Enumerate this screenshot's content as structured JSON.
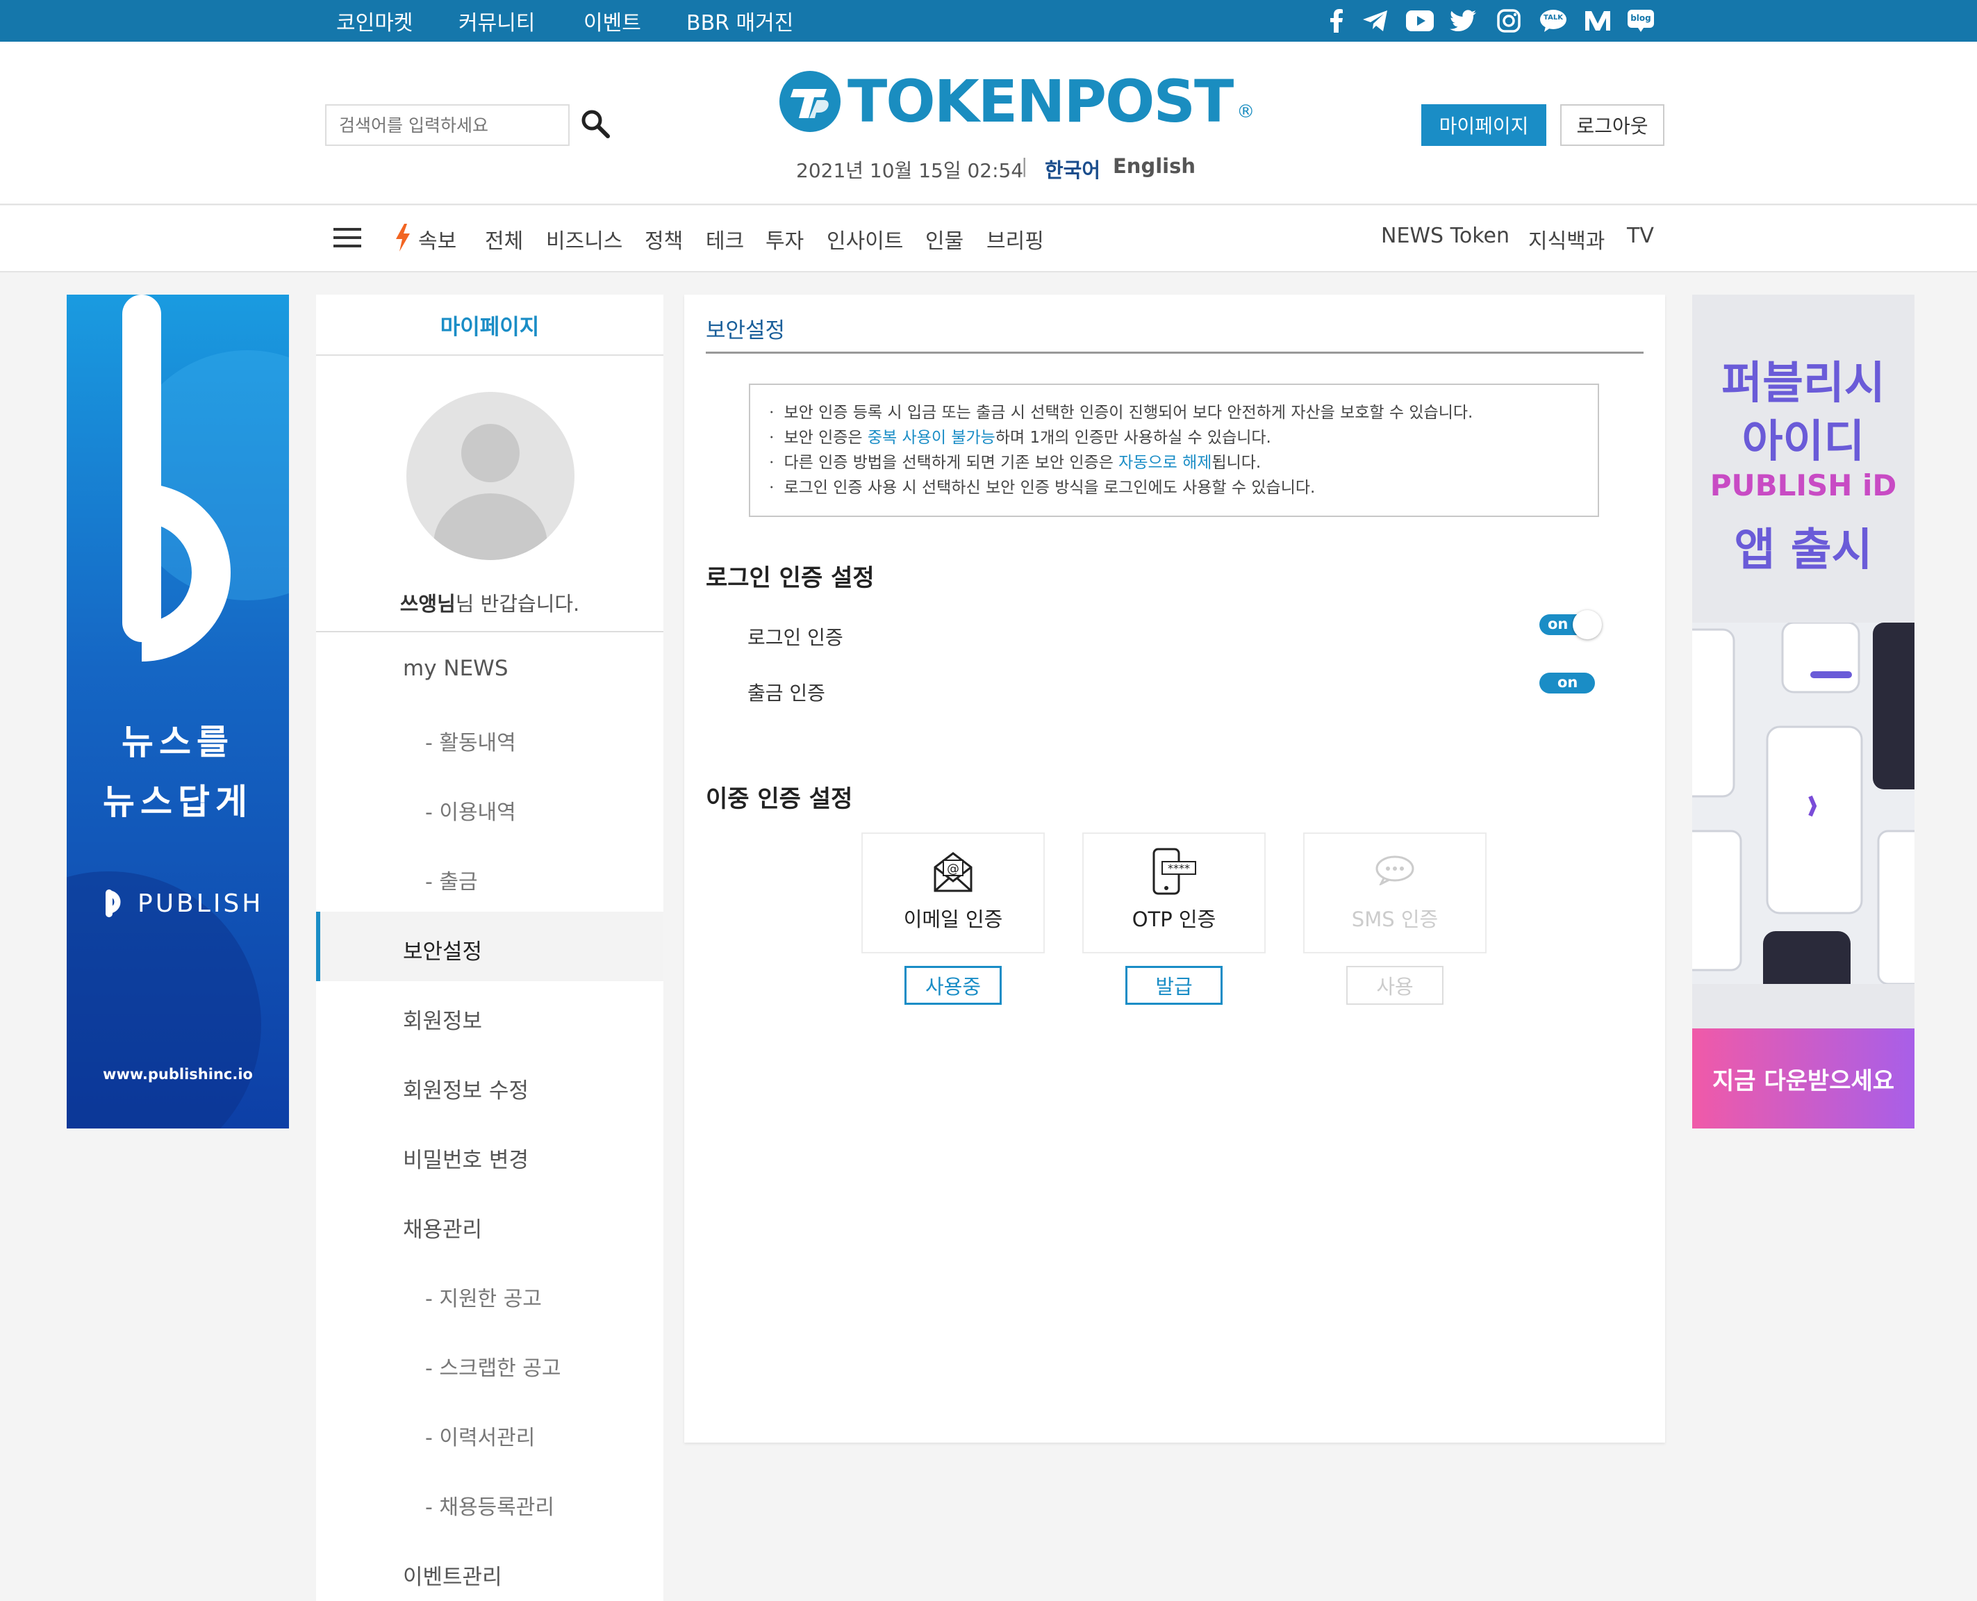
{
  "colors": {
    "brand": "#1a8dc6",
    "topbar": "#1577ab",
    "accent_orange": "#f26522"
  },
  "topbar": {
    "links": [
      "코인마켓",
      "커뮤니티",
      "이벤트",
      "BBR 매거진"
    ],
    "social_icons": [
      "facebook-icon",
      "telegram-icon",
      "youtube-icon",
      "twitter-icon",
      "instagram-icon",
      "kakaotalk-icon",
      "medium-icon",
      "blog-icon"
    ],
    "talk_label": "TALK",
    "blog_label": "blog"
  },
  "header": {
    "search_placeholder": "검색어를 입력하세요",
    "logo_text": "TOKENPOST",
    "logo_reg": "®",
    "datetime": "2021년 10월 15일 02:54",
    "lang_separator": "|",
    "lang_ko": "한국어",
    "lang_en": "English",
    "mypage_label": "마이페이지",
    "logout_label": "로그아웃"
  },
  "nav": {
    "breaking": "속보",
    "items": [
      "전체",
      "비즈니스",
      "정책",
      "테크",
      "투자",
      "인사이트",
      "인물",
      "브리핑"
    ],
    "right_items": [
      "NEWS Token",
      "지식백과",
      "TV"
    ]
  },
  "ad_left": {
    "slogan_1": "뉴스를",
    "slogan_2": "뉴스답게",
    "brand": "PUBLISH",
    "url": "www.publishinc.io"
  },
  "ad_right": {
    "title_1": "퍼블리시",
    "title_2": "아이디",
    "brand": "PUBLISH iD",
    "title_3": "앱 출시",
    "cta": "지금 다운받으세요"
  },
  "sidebar": {
    "title": "마이페이지",
    "greeting_name": "쓰앵님",
    "greeting_rest": "님 반갑습니다.",
    "menu": [
      {
        "label": "my NEWS",
        "sub": false
      },
      {
        "label": "- 활동내역",
        "sub": true
      },
      {
        "label": "- 이용내역",
        "sub": true
      },
      {
        "label": "- 출금",
        "sub": true
      },
      {
        "label": "보안설정",
        "sub": false,
        "active": true
      },
      {
        "label": "회원정보",
        "sub": false
      },
      {
        "label": "회원정보 수정",
        "sub": false
      },
      {
        "label": "비밀번호 변경",
        "sub": false
      },
      {
        "label": "채용관리",
        "sub": false
      },
      {
        "label": "- 지원한 공고",
        "sub": true
      },
      {
        "label": "- 스크랩한 공고",
        "sub": true
      },
      {
        "label": "- 이력서관리",
        "sub": true
      },
      {
        "label": "- 채용등록관리",
        "sub": true
      },
      {
        "label": "이벤트관리",
        "sub": false
      }
    ]
  },
  "main": {
    "title": "보안설정",
    "notice": {
      "line1": "ㆍ 보안 인증 등록 시 입금 또는 출금 시 선택한 인증이 진행되어 보다 안전하게 자산을 보호할 수 있습니다.",
      "line2_pre": "ㆍ 보안 인증은 ",
      "line2_hl": "중복 사용이 불가능",
      "line2_post": "하며 1개의 인증만 사용하실 수 있습니다.",
      "line3_pre": "ㆍ 다른 인증 방법을 선택하게 되면 기존 보안 인증은 ",
      "line3_hl": "자동으로 해제",
      "line3_post": "됩니다.",
      "line4": "ㆍ 로그인 인증 사용 시 선택하신 보안 인증 방식을 로그인에도 사용할 수 있습니다."
    },
    "login_section": {
      "title": "로그인 인증 설정",
      "login_auth_label": "로그인 인증",
      "login_auth_state": "on",
      "withdraw_auth_label": "출금 인증",
      "withdraw_auth_state": "on"
    },
    "twofa_section": {
      "title": "이중 인증 설정",
      "methods": [
        {
          "label": "이메일 인증",
          "button": "사용중",
          "icon": "email-icon",
          "disabled": false
        },
        {
          "label": "OTP 인증",
          "button": "발급",
          "icon": "otp-phone-icon",
          "disabled": false
        },
        {
          "label": "SMS 인증",
          "button": "사용",
          "icon": "sms-icon",
          "disabled": true
        }
      ],
      "otp_mask": "****"
    }
  }
}
